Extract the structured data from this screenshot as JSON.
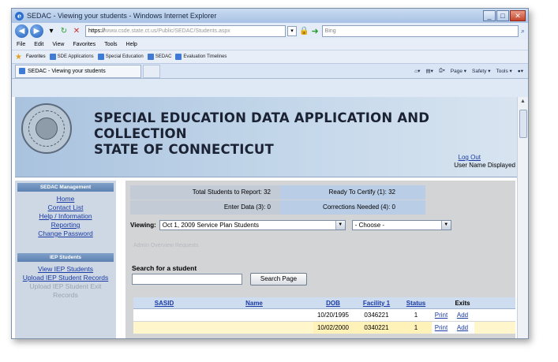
{
  "window": {
    "title": "SEDAC - Viewing your students - Windows Internet Explorer",
    "minimize_glyph": "_",
    "maximize_glyph": "□",
    "close_glyph": "✕"
  },
  "address": {
    "url_scheme": "https://",
    "url_host_blurred": "www.csde.state.ct.us/",
    "url_path_blurred": "Public/SEDAC/Students.aspx",
    "search_placeholder": "Bing"
  },
  "menu": [
    "File",
    "Edit",
    "View",
    "Favorites",
    "Tools",
    "Help"
  ],
  "favorites": {
    "label": "Favorites",
    "links": [
      "SDE Applications",
      "Special Education",
      "SEDAC",
      "Evaluation Timelines"
    ]
  },
  "tab": {
    "label": "SEDAC - Viewing your students"
  },
  "command_bar": [
    "Page ▾",
    "Safety ▾",
    "Tools ▾"
  ],
  "banner": {
    "title_line1": "SPECIAL EDUCATION DATA APPLICATION AND COLLECTION",
    "title_line2": "STATE OF CONNECTICUT",
    "logout": "Log Out",
    "username": "User Name Displayed"
  },
  "sidebar": {
    "management": {
      "heading": "SEDAC Management",
      "links": [
        "Home",
        "Contact List",
        "Help / Information",
        "Reporting",
        "Change Password"
      ]
    },
    "iep": {
      "heading": "IEP Students",
      "links": [
        "View IEP Students",
        "Upload IEP Student Records",
        "Upload IEP Student Exit Records"
      ]
    }
  },
  "summary": {
    "total_label": "Total Students to Report:",
    "total_value": "32",
    "enter_label": "Enter Data (3):",
    "enter_value": "0",
    "ready_label": "Ready To Certify (1):",
    "ready_value": "32",
    "corrections_label": "Corrections Needed (4):",
    "corrections_value": "0"
  },
  "viewing": {
    "label": "Viewing:",
    "selected": "Oct 1, 2009 Service Plan Students",
    "second_selected": "- Choose -"
  },
  "adhoc_label": "Admin Overview Requests",
  "search": {
    "label": "Search for a student",
    "button": "Search Page"
  },
  "table": {
    "headers": [
      "SASID",
      "Name",
      "DOB",
      "Facility 1",
      "Status",
      "",
      "Exits"
    ],
    "rows": [
      {
        "sasid": "",
        "name": "",
        "dob": "10/20/1995",
        "facility": "0346221",
        "status": "1",
        "print": "Print",
        "exit": "Add"
      },
      {
        "sasid": "",
        "name": "",
        "dob": "10/02/2000",
        "facility": "0340221",
        "status": "1",
        "print": "Print",
        "exit": "Add"
      }
    ]
  }
}
